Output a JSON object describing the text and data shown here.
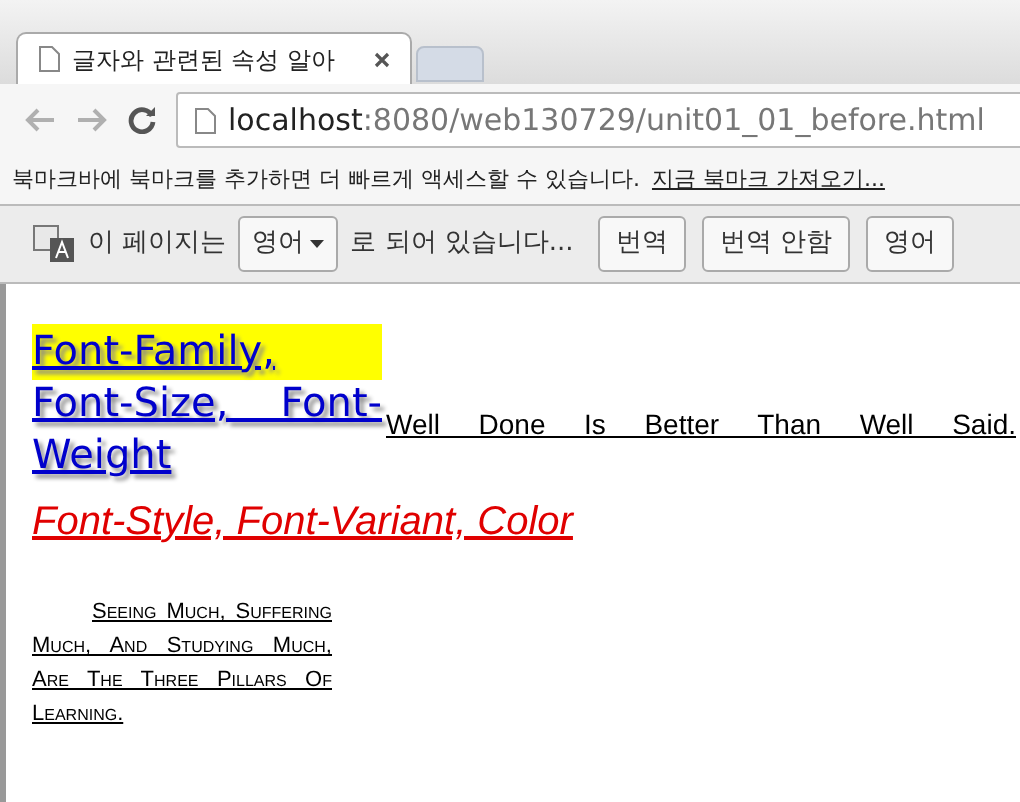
{
  "tab": {
    "title": "글자와 관련된 속성 알아",
    "selected": true
  },
  "address": {
    "host": "localhost",
    "path": ":8080/web130729/unit01_01_before.html"
  },
  "bookmark_bar": {
    "message": "북마크바에 북마크를 추가하면 더 빠르게 액세스할 수 있습니다.",
    "link": "지금 북마크 가져오기..."
  },
  "translate_bar": {
    "prefix": "이 페이지는",
    "language": "영어",
    "suffix": "로 되어 있습니다...",
    "buttons": [
      "번역",
      "번역 안함",
      "영어"
    ]
  },
  "page": {
    "heading": "Font-Family, Font-Size, Font-Weight",
    "aside": "Well Done Is Better Than Well Said.",
    "subheading": "Font-Style, Font-Variant, Color",
    "quote": "Seeing Much, Suffering Much, And Studying Much, Are The Three Pillars Of Learning."
  }
}
